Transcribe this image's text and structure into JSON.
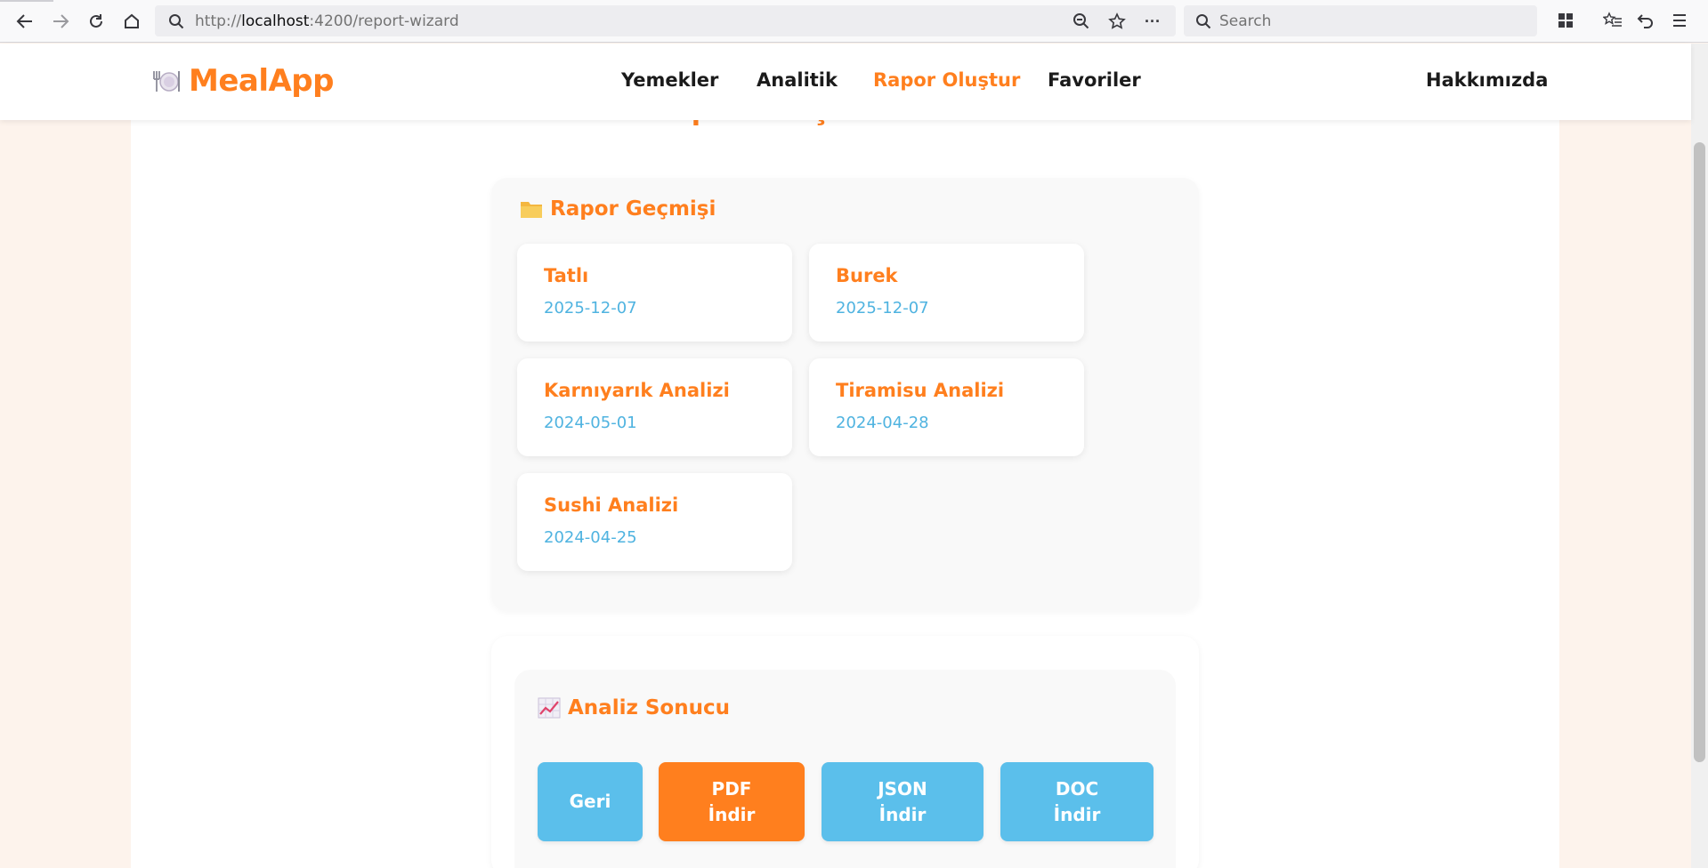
{
  "browser": {
    "url_host": "localhost",
    "url_prefix": "http://",
    "url_suffix": ":4200/report-wizard",
    "search_placeholder": "Search"
  },
  "header": {
    "logo_text": "MealApp",
    "nav": {
      "yemekler": "Yemekler",
      "analitik": "Analitik",
      "rapor": "Rapor Oluştur",
      "favoriler": "Favoriler",
      "hakkimizda": "Hakkımızda"
    }
  },
  "page": {
    "ghost_title": "Rapor Oluştur"
  },
  "history": {
    "title": "Rapor Geçmişi",
    "items": [
      {
        "title": "Tatlı",
        "date": "2025-12-07"
      },
      {
        "title": "Burek",
        "date": "2025-12-07"
      },
      {
        "title": "Karnıyarık Analizi",
        "date": "2024-05-01"
      },
      {
        "title": "Tiramisu Analizi",
        "date": "2024-04-28"
      },
      {
        "title": "Sushi Analizi",
        "date": "2024-04-25"
      }
    ]
  },
  "result": {
    "title": "Analiz Sonucu",
    "buttons": {
      "back": "Geri",
      "pdf_line1": "PDF",
      "pdf_line2": "İndir",
      "json_line1": "JSON",
      "json_line2": "İndir",
      "doc_line1": "DOC",
      "doc_line2": "İndir"
    }
  },
  "colors": {
    "accent": "#ff7f1e",
    "secondary": "#5bbfeb",
    "date": "#4fb3e0",
    "background": "#fdf3ec"
  }
}
